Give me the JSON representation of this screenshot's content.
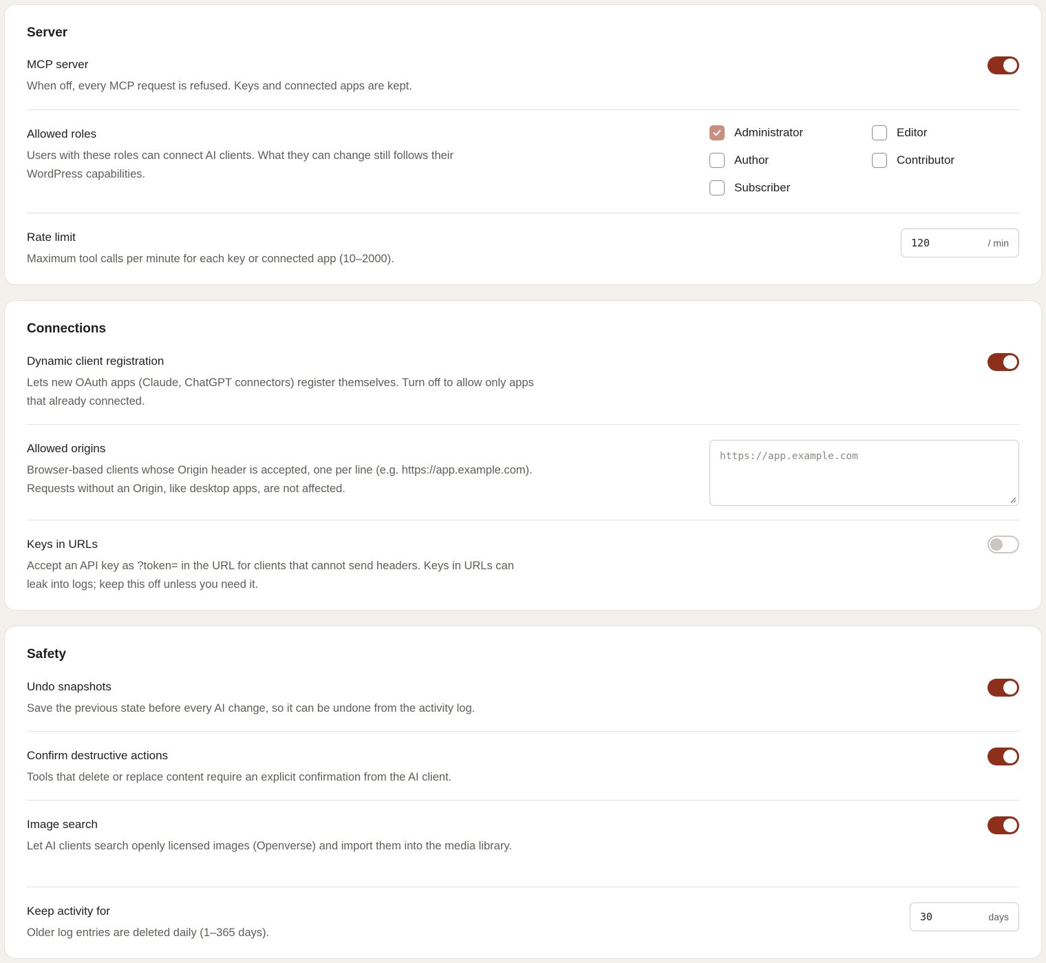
{
  "colors": {
    "accent": "#8e2f1c",
    "checkbox_checked": "#c99082",
    "background": "#f4f0ec"
  },
  "server": {
    "title": "Server",
    "mcp_server": {
      "label": "MCP server",
      "description": "When off, every MCP request is refused. Keys and connected apps are kept.",
      "enabled": true
    },
    "allowed_roles": {
      "label": "Allowed roles",
      "description": "Users with these roles can connect AI clients. What they can change still follows their WordPress capabilities.",
      "roles": [
        {
          "label": "Administrator",
          "checked": true
        },
        {
          "label": "Editor",
          "checked": false
        },
        {
          "label": "Author",
          "checked": false
        },
        {
          "label": "Contributor",
          "checked": false
        },
        {
          "label": "Subscriber",
          "checked": false
        }
      ]
    },
    "rate_limit": {
      "label": "Rate limit",
      "description": "Maximum tool calls per minute for each key or connected app (10–2000).",
      "value": "120",
      "unit": "/ min"
    }
  },
  "connections": {
    "title": "Connections",
    "dynamic_registration": {
      "label": "Dynamic client registration",
      "description": "Lets new OAuth apps (Claude, ChatGPT connectors) register themselves. Turn off to allow only apps that already connected.",
      "enabled": true
    },
    "allowed_origins": {
      "label": "Allowed origins",
      "description": "Browser-based clients whose Origin header is accepted, one per line (e.g. https://app.example.com). Requests without an Origin, like desktop apps, are not affected.",
      "value": "",
      "placeholder": "https://app.example.com"
    },
    "keys_in_urls": {
      "label": "Keys in URLs",
      "description": "Accept an API key as ?token= in the URL for clients that cannot send headers. Keys in URLs can leak into logs; keep this off unless you need it.",
      "enabled": false
    }
  },
  "safety": {
    "title": "Safety",
    "undo_snapshots": {
      "label": "Undo snapshots",
      "description": "Save the previous state before every AI change, so it can be undone from the activity log.",
      "enabled": true
    },
    "confirm_destructive": {
      "label": "Confirm destructive actions",
      "description": "Tools that delete or replace content require an explicit confirmation from the AI client.",
      "enabled": true
    },
    "image_search": {
      "label": "Image search",
      "description": "Let AI clients search openly licensed images (Openverse) and import them into the media library.",
      "enabled": true
    },
    "keep_activity": {
      "label": "Keep activity for",
      "description": "Older log entries are deleted daily (1–365 days).",
      "value": "30",
      "unit": "days"
    }
  }
}
